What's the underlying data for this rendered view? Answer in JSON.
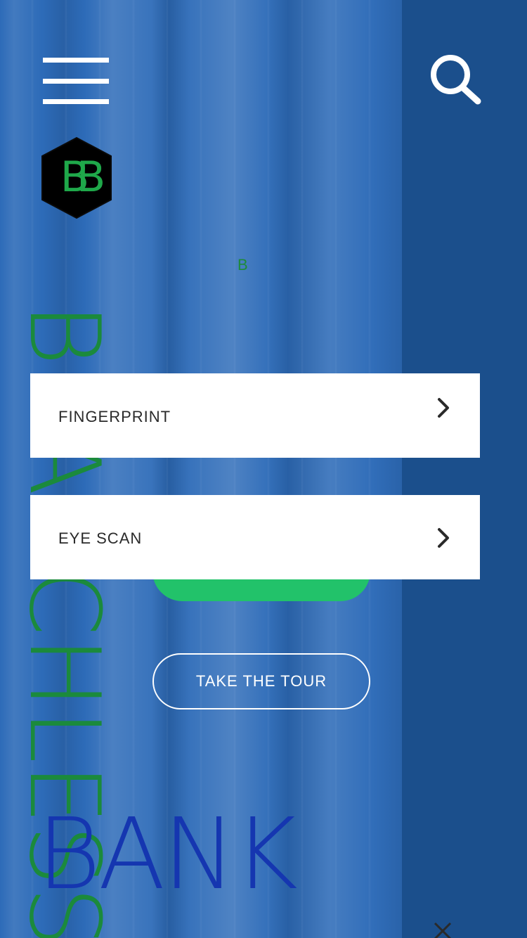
{
  "brand": {
    "logo_letters": "BB",
    "small_letter": "B",
    "vertical_word": "BRANCHLESS",
    "bank_word": "BANK",
    "colors": {
      "green": "#1b8a3c",
      "bank_blue": "#1536b0",
      "panel": "#1b4f8c",
      "button_green": "#22c26a"
    }
  },
  "header": {
    "menu_icon": "hamburger-icon",
    "search_icon": "search-icon"
  },
  "options": [
    {
      "label": "FINGERPRINT",
      "icon": "chevron-right-icon"
    },
    {
      "label": "EYE SCAN",
      "icon": "chevron-right-icon"
    }
  ],
  "actions": {
    "tour_label": "TAKE THE TOUR"
  },
  "footer": {
    "close_icon": "close-icon"
  }
}
